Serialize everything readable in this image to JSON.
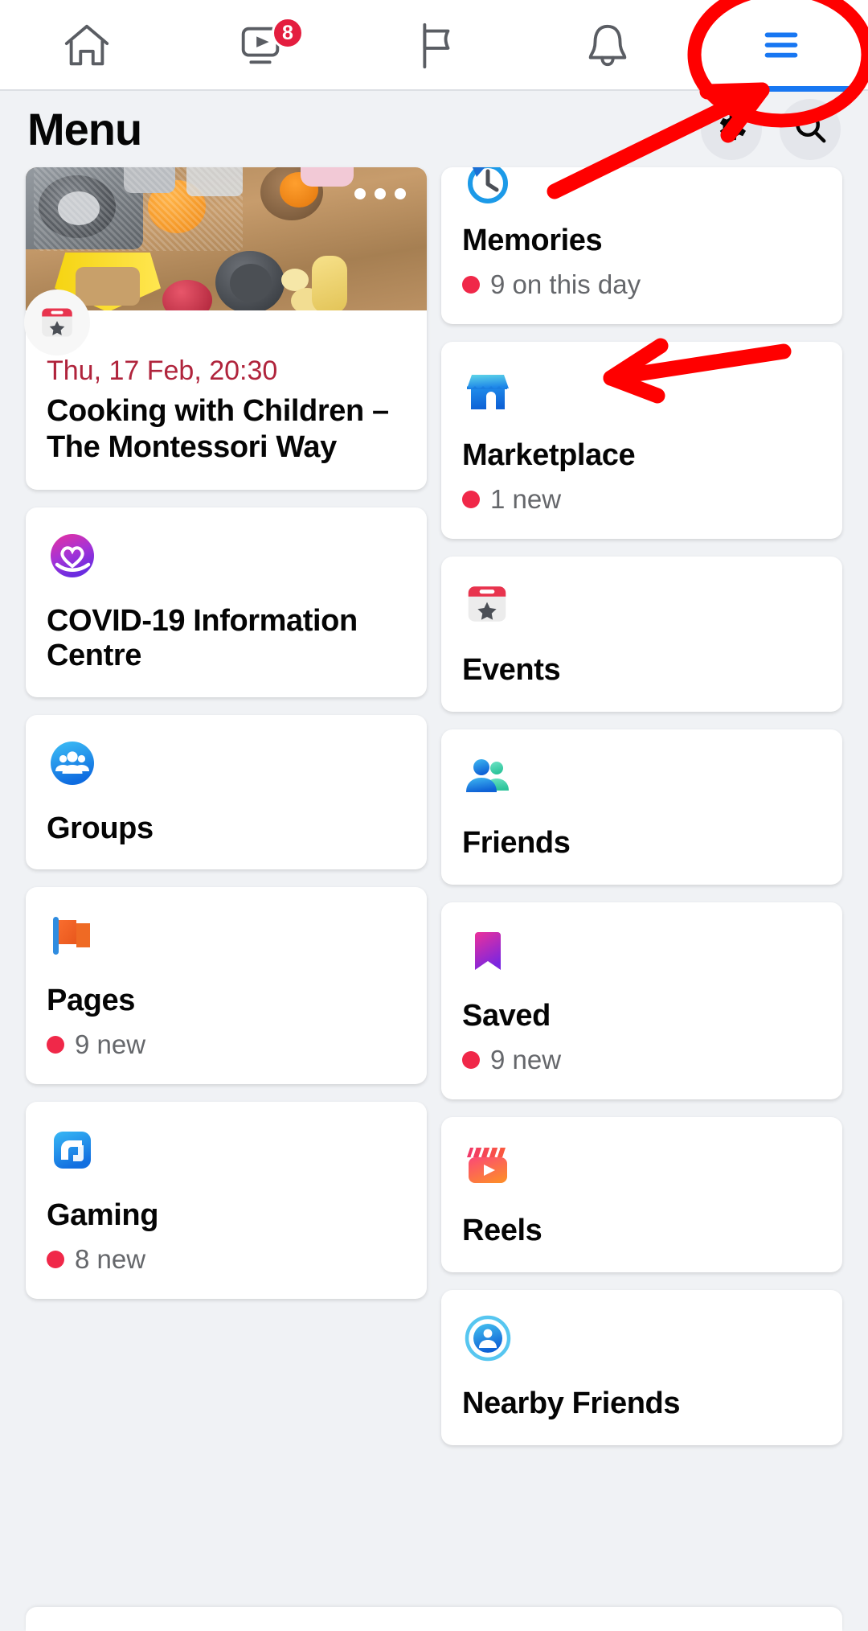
{
  "topnav": {
    "items": [
      {
        "name": "home-tab",
        "icon": "home-icon",
        "badge": null,
        "active": false
      },
      {
        "name": "video-tab",
        "icon": "video-play-icon",
        "badge": "8",
        "active": false
      },
      {
        "name": "pages-feed-tab",
        "icon": "flag-icon",
        "badge": null,
        "active": false
      },
      {
        "name": "notifications-tab",
        "icon": "bell-icon",
        "badge": null,
        "active": false
      },
      {
        "name": "menu-tab",
        "icon": "hamburger-menu-icon",
        "badge": null,
        "active": true
      }
    ]
  },
  "header": {
    "title": "Menu",
    "settings_icon": "gear-icon",
    "search_icon": "search-icon"
  },
  "event_card": {
    "more_icon": "more-options-icon",
    "badge_icon": "event-calendar-star-icon",
    "date": "Thu, 17 Feb, 20:30",
    "title": "Cooking with Children – The Montessori Way"
  },
  "left_column": [
    {
      "name": "covid-19-information-centre",
      "icon": "covid-heart-icon",
      "label": "COVID-19 Information Centre",
      "sub": null
    },
    {
      "name": "groups",
      "icon": "groups-people-icon",
      "label": "Groups",
      "sub": null
    },
    {
      "name": "pages",
      "icon": "pages-flag-icon",
      "label": "Pages",
      "sub": "9 new"
    },
    {
      "name": "gaming",
      "icon": "gaming-controller-icon",
      "label": "Gaming",
      "sub": "8 new"
    }
  ],
  "right_column": [
    {
      "name": "memories",
      "icon": "memories-clock-icon",
      "label": "Memories",
      "sub": "9 on this day"
    },
    {
      "name": "marketplace",
      "icon": "marketplace-shop-icon",
      "label": "Marketplace",
      "sub": "1 new"
    },
    {
      "name": "events",
      "icon": "events-calendar-icon",
      "label": "Events",
      "sub": null
    },
    {
      "name": "friends",
      "icon": "friends-people-icon",
      "label": "Friends",
      "sub": null
    },
    {
      "name": "saved",
      "icon": "saved-bookmark-icon",
      "label": "Saved",
      "sub": "9 new"
    },
    {
      "name": "reels",
      "icon": "reels-clapper-icon",
      "label": "Reels",
      "sub": null
    },
    {
      "name": "nearby-friends",
      "icon": "nearby-friends-icon",
      "label": "Nearby Friends",
      "sub": null
    }
  ],
  "annotations": {
    "circle_target": "hamburger-menu-icon",
    "arrow_targets": [
      "hamburger-menu-icon",
      "marketplace"
    ],
    "color": "#ff0000"
  },
  "colors": {
    "background": "#f0f2f5",
    "card": "#ffffff",
    "accent_blue": "#1877f2",
    "badge_red": "#e41e3f",
    "dot_red": "#f02849",
    "date_red": "#b0243c",
    "text_primary": "#050505",
    "text_secondary": "#65676b"
  }
}
